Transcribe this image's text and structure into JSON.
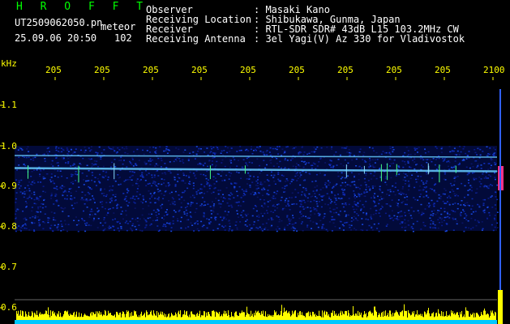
{
  "header": {
    "app_title": "H R O F F T",
    "filename": "UT2509062050.pn",
    "tag": "meteor",
    "datetime": "25.09.06 20:50",
    "count": "102"
  },
  "info": {
    "labels": [
      "Observer",
      "Receiving Location",
      "Receiver",
      "Receiving Antenna"
    ],
    "values": [
      ": Masaki Kano",
      ": Shibukawa, Gunma, Japan",
      ": RTL-SDR SDR# 43dB L15 103.2MHz CW",
      ": 3el Yagi(V) Az 330 for Vladivostok"
    ]
  },
  "axis": {
    "y_unit": "kHz",
    "y_ticks": [
      "1.1",
      "1.0",
      "0.9",
      "0.8",
      "0.7",
      "0.6"
    ],
    "x_ticks": [
      "205",
      "205",
      "205",
      "205",
      "205",
      "205",
      "205",
      "205",
      "205",
      "2100"
    ]
  },
  "chart_data": {
    "type": "heatmap",
    "ylabel": "kHz",
    "y_range_khz": [
      0.575,
      1.15
    ],
    "signal_band_khz": [
      0.79,
      1.0
    ],
    "traces_khz": [
      0.98,
      0.945
    ]
  },
  "colors": {
    "title": "#00ff00",
    "ticks": "#ffff00",
    "text": "#ffffff",
    "background": "#000000",
    "noise": "#0a1a8a",
    "trace": "#66ccff",
    "bar": "#ffff00",
    "baseline": "#00c8ff",
    "hot": "#ff3388"
  }
}
